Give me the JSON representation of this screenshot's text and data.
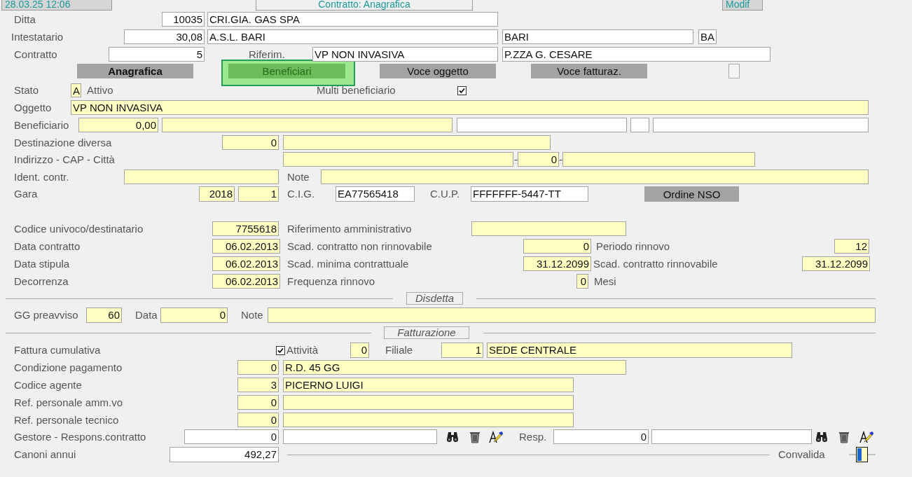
{
  "header": [
    {
      "kind": "status",
      "text": "28.03.25 12:06"
    },
    {
      "kind": "title",
      "text": "Contratto: Anagrafica"
    },
    {
      "kind": "status",
      "text": "Modif"
    }
  ],
  "rows": [
    {
      "items": [
        {
          "kind": "label",
          "text": "Ditta"
        },
        {
          "kind": "field",
          "value": "10035",
          "editable": false
        },
        {
          "kind": "field",
          "value": "CRI.GIA. GAS SPA",
          "editable": false
        }
      ]
    },
    {
      "items": [
        {
          "kind": "label",
          "text": "Intestatario"
        },
        {
          "kind": "field",
          "value": "30,08",
          "editable": false
        },
        {
          "kind": "field",
          "value": "A.S.L. BARI",
          "editable": false
        },
        {
          "kind": "field",
          "value": "BARI",
          "editable": false
        },
        {
          "kind": "field",
          "value": "BA",
          "editable": false
        }
      ]
    },
    {
      "items": [
        {
          "kind": "label",
          "text": "Contratto"
        },
        {
          "kind": "field",
          "value": "5",
          "editable": false
        },
        {
          "kind": "label",
          "text": "Riferim."
        },
        {
          "kind": "field",
          "value": "VP NON INVASIVA",
          "editable": false
        },
        {
          "kind": "field",
          "value": "P.ZZA G. CESARE",
          "editable": false
        }
      ]
    },
    {
      "items": [
        {
          "kind": "tab",
          "label": "Anagrafica",
          "selected": true,
          "highlighted": false
        },
        {
          "kind": "tab",
          "label": "Beneficiari",
          "selected": false,
          "highlighted": true
        },
        {
          "kind": "tab",
          "label": "Voce oggetto",
          "selected": false,
          "highlighted": false
        },
        {
          "kind": "tab",
          "label": "Voce fatturaz.",
          "selected": false,
          "highlighted": false
        },
        {
          "kind": "blank-button"
        }
      ]
    },
    {
      "items": [
        {
          "kind": "label",
          "text": "Stato"
        },
        {
          "kind": "field",
          "value": "A",
          "editable": true
        },
        {
          "kind": "label",
          "text": "Attivo"
        },
        {
          "kind": "label",
          "text": "Multi beneficiario"
        },
        {
          "kind": "checkbox",
          "checked": true
        }
      ]
    },
    {
      "items": [
        {
          "kind": "label",
          "text": "Oggetto"
        },
        {
          "kind": "field",
          "value": "VP NON INVASIVA",
          "editable": true
        }
      ]
    },
    {
      "items": [
        {
          "kind": "label",
          "text": "Beneficiario"
        },
        {
          "kind": "field",
          "value": "0,00",
          "editable": true
        },
        {
          "kind": "field",
          "editable": true
        },
        {
          "kind": "field",
          "editable": false
        },
        {
          "kind": "field",
          "editable": false
        },
        {
          "kind": "field",
          "editable": false
        }
      ]
    },
    {
      "items": [
        {
          "kind": "label",
          "text": "Destinazione diversa"
        },
        {
          "kind": "field",
          "value": "0",
          "editable": true
        },
        {
          "kind": "field",
          "editable": true
        }
      ]
    },
    {
      "items": [
        {
          "kind": "label",
          "text": "Indirizzo - CAP - Città"
        },
        {
          "kind": "field",
          "editable": true
        },
        {
          "kind": "label",
          "text": "-"
        },
        {
          "kind": "field",
          "value": "0",
          "editable": true
        },
        {
          "kind": "label",
          "text": "-"
        },
        {
          "kind": "field",
          "editable": true
        }
      ]
    },
    {
      "items": [
        {
          "kind": "label",
          "text": "Ident. contr."
        },
        {
          "kind": "field",
          "editable": true
        },
        {
          "kind": "label",
          "text": "Note"
        },
        {
          "kind": "field",
          "editable": true
        }
      ]
    },
    {
      "items": [
        {
          "kind": "label",
          "text": "Gara"
        },
        {
          "kind": "field",
          "value": "2018",
          "editable": true
        },
        {
          "kind": "field",
          "value": "1",
          "editable": true
        },
        {
          "kind": "label",
          "text": "C.I.G."
        },
        {
          "kind": "field",
          "value": "EA77565418",
          "editable": false
        },
        {
          "kind": "label",
          "text": "C.U.P."
        },
        {
          "kind": "field",
          "value": "FFFFFFF-5447-TT",
          "editable": false
        },
        {
          "kind": "button",
          "label": "Ordine NSO"
        }
      ]
    },
    {
      "items": [
        {
          "kind": "label",
          "text": "Codice univoco/destinatario"
        },
        {
          "kind": "field",
          "value": "7755618",
          "editable": true
        },
        {
          "kind": "label",
          "text": "Riferimento amministrativo"
        },
        {
          "kind": "field",
          "editable": true
        }
      ]
    },
    {
      "items": [
        {
          "kind": "label",
          "text": "Data contratto"
        },
        {
          "kind": "field",
          "value": "06.02.2013",
          "editable": true
        },
        {
          "kind": "label",
          "text": "Scad. contratto non rinnovabile"
        },
        {
          "kind": "field",
          "value": "0",
          "editable": true
        },
        {
          "kind": "label",
          "text": "Periodo rinnovo"
        },
        {
          "kind": "field",
          "value": "12",
          "editable": true
        }
      ]
    },
    {
      "items": [
        {
          "kind": "label",
          "text": "Data stipula"
        },
        {
          "kind": "field",
          "value": "06.02.2013",
          "editable": true
        },
        {
          "kind": "label",
          "text": "Scad. minima contrattuale"
        },
        {
          "kind": "field",
          "value": "31.12.2099",
          "editable": true
        },
        {
          "kind": "label",
          "text": "Scad. contratto rinnovabile"
        },
        {
          "kind": "field",
          "value": "31.12.2099",
          "editable": true
        }
      ]
    },
    {
      "items": [
        {
          "kind": "label",
          "text": "Decorrenza"
        },
        {
          "kind": "field",
          "value": "06.02.2013",
          "editable": true
        },
        {
          "kind": "label",
          "text": "Frequenza rinnovo"
        },
        {
          "kind": "field",
          "value": "0",
          "editable": true
        },
        {
          "kind": "label",
          "text": "Mesi"
        }
      ]
    },
    {
      "items": [
        {
          "kind": "section",
          "title": "Disdetta"
        }
      ]
    },
    {
      "items": [
        {
          "kind": "label",
          "text": "GG preavviso"
        },
        {
          "kind": "field",
          "value": "60",
          "editable": true
        },
        {
          "kind": "label",
          "text": "Data"
        },
        {
          "kind": "field",
          "value": "0",
          "editable": true
        },
        {
          "kind": "label",
          "text": "Note"
        },
        {
          "kind": "field",
          "editable": true
        }
      ]
    },
    {
      "items": [
        {
          "kind": "section",
          "title": "Fatturazione"
        }
      ]
    },
    {
      "items": [
        {
          "kind": "label",
          "text": "Fattura cumulativa"
        },
        {
          "kind": "checkbox",
          "checked": true
        },
        {
          "kind": "label",
          "text": "Attività"
        },
        {
          "kind": "field",
          "value": "0",
          "editable": true
        },
        {
          "kind": "label",
          "text": "Filiale"
        },
        {
          "kind": "field",
          "value": "1",
          "editable": true
        },
        {
          "kind": "field",
          "value": "SEDE CENTRALE",
          "editable": true
        }
      ]
    },
    {
      "items": [
        {
          "kind": "label",
          "text": "Condizione pagamento"
        },
        {
          "kind": "field",
          "value": "0",
          "editable": true
        },
        {
          "kind": "field",
          "value": "R.D. 45 GG",
          "editable": true
        }
      ]
    },
    {
      "items": [
        {
          "kind": "label",
          "text": "Codice agente"
        },
        {
          "kind": "field",
          "value": "3",
          "editable": true
        },
        {
          "kind": "field",
          "value": "PICERNO LUIGI",
          "editable": true
        }
      ]
    },
    {
      "items": [
        {
          "kind": "label",
          "text": "Ref. personale amm.vo"
        },
        {
          "kind": "field",
          "value": "0",
          "editable": true
        },
        {
          "kind": "field",
          "editable": true
        }
      ]
    },
    {
      "items": [
        {
          "kind": "label",
          "text": "Ref. personale tecnico"
        },
        {
          "kind": "field",
          "value": "0",
          "editable": true
        },
        {
          "kind": "field",
          "editable": true
        }
      ]
    },
    {
      "items": [
        {
          "kind": "label",
          "text": "Gestore - Respons.contratto"
        },
        {
          "kind": "field",
          "value": "0",
          "editable": false
        },
        {
          "kind": "field",
          "editable": false
        },
        {
          "kind": "search-tool"
        },
        {
          "kind": "delete-tool"
        },
        {
          "kind": "edit-tool"
        },
        {
          "kind": "label",
          "text": "Resp."
        },
        {
          "kind": "field",
          "value": "0",
          "editable": false
        },
        {
          "kind": "field",
          "editable": false
        },
        {
          "kind": "search-tool"
        },
        {
          "kind": "delete-tool"
        },
        {
          "kind": "edit-tool"
        }
      ]
    },
    {
      "items": [
        {
          "kind": "label",
          "text": "Canoni annui"
        },
        {
          "kind": "field",
          "value": "492,27",
          "editable": false
        },
        {
          "kind": "label",
          "text": "Convalida"
        },
        {
          "kind": "validation-toggle"
        }
      ]
    }
  ]
}
